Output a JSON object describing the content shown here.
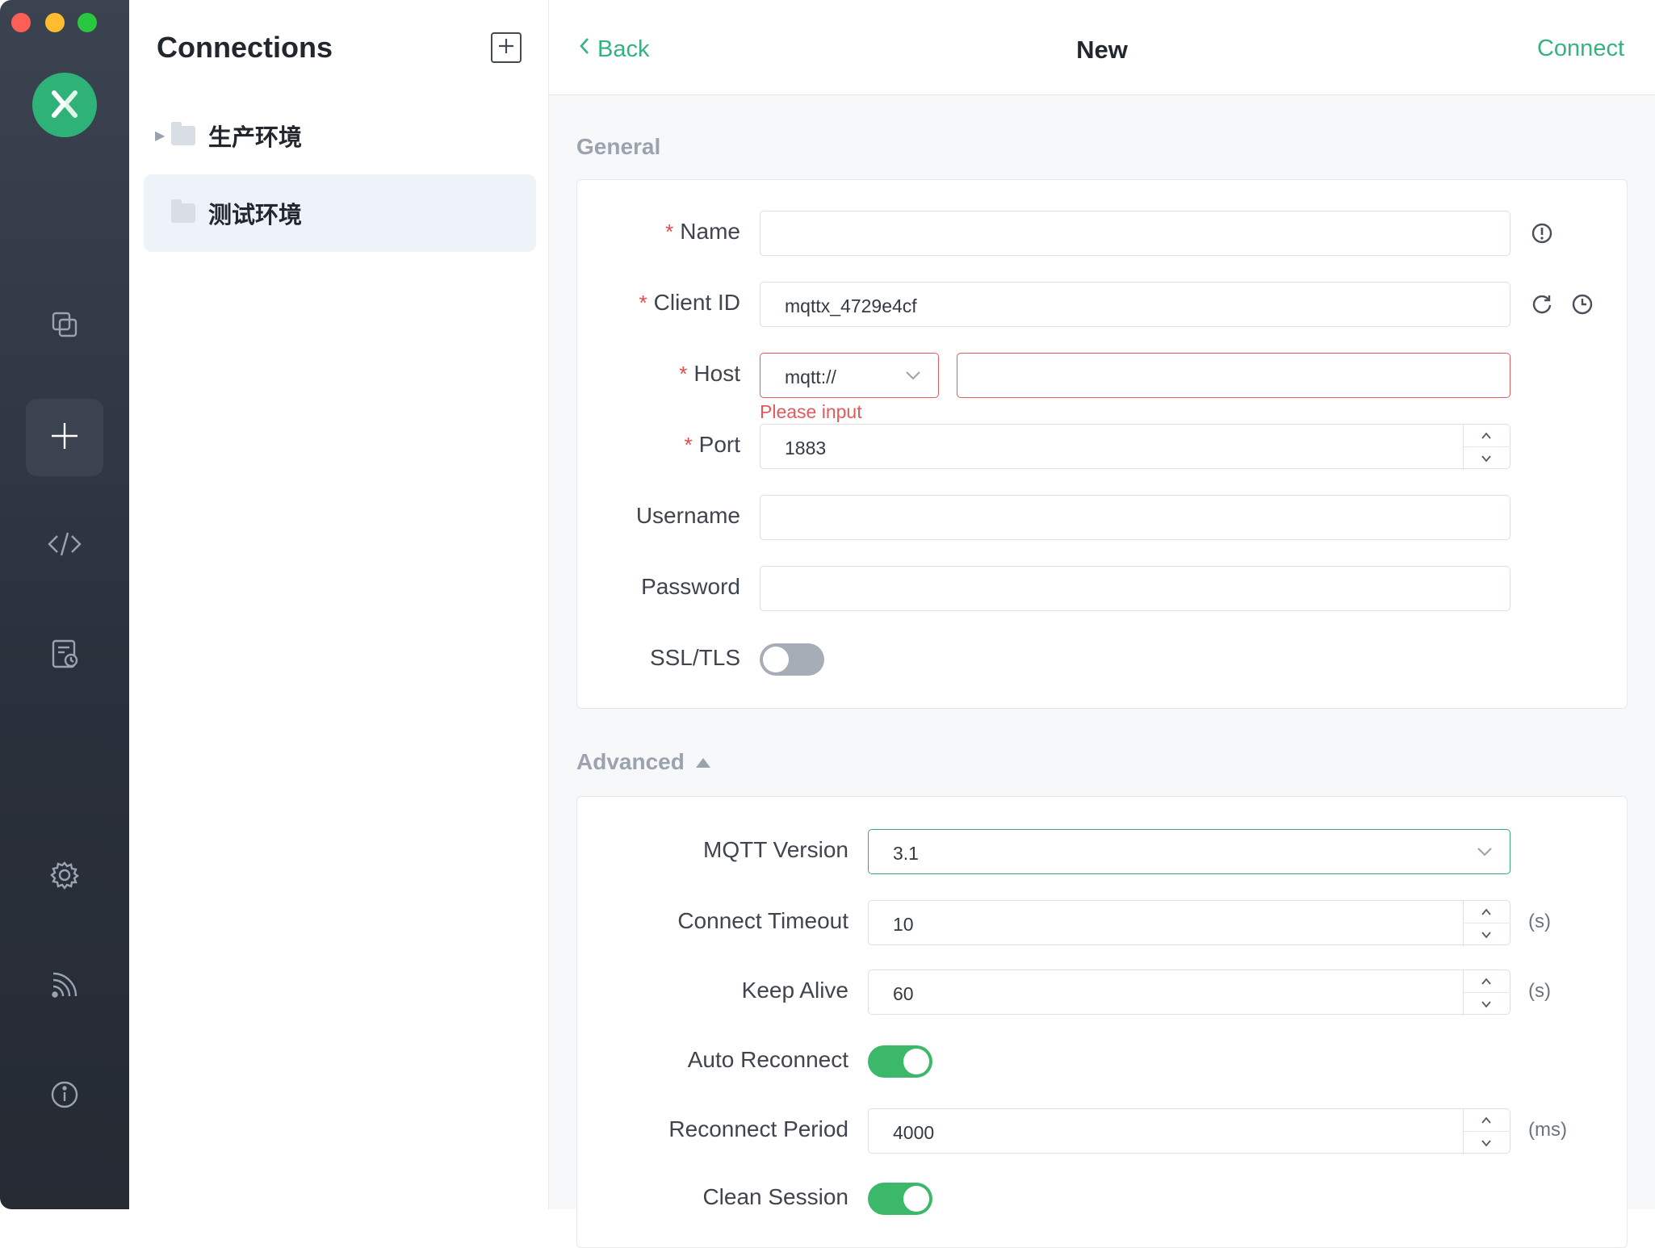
{
  "window": {
    "title": "New"
  },
  "rail": {
    "items": [
      {
        "name": "connections",
        "icon": "copy-icon",
        "active": false
      },
      {
        "name": "new-connection",
        "icon": "plus-icon",
        "active": true
      },
      {
        "name": "script",
        "icon": "code-icon",
        "active": false
      },
      {
        "name": "log",
        "icon": "log-clock-icon",
        "active": false
      },
      {
        "name": "settings",
        "icon": "gear-icon",
        "active": false
      },
      {
        "name": "subscriptions",
        "icon": "rss-icon",
        "active": false
      },
      {
        "name": "about",
        "icon": "info-icon",
        "active": false
      }
    ]
  },
  "connections": {
    "title": "Connections",
    "groups": [
      {
        "label": "生产环境",
        "expandable": true,
        "selected": false
      },
      {
        "label": "测试环境",
        "expandable": false,
        "selected": true
      }
    ]
  },
  "header": {
    "back_label": "Back",
    "title": "New",
    "connect_label": "Connect"
  },
  "general": {
    "section_title": "General",
    "name": {
      "label": "Name",
      "value": ""
    },
    "client_id": {
      "label": "Client ID",
      "value": "mqttx_4729e4cf"
    },
    "host": {
      "label": "Host",
      "protocol": "mqtt://",
      "value": "",
      "error": "Please input"
    },
    "port": {
      "label": "Port",
      "value": "1883"
    },
    "username": {
      "label": "Username",
      "value": ""
    },
    "password": {
      "label": "Password",
      "value": ""
    },
    "ssl": {
      "label": "SSL/TLS",
      "enabled": false
    }
  },
  "advanced": {
    "section_title": "Advanced",
    "mqtt_version": {
      "label": "MQTT Version",
      "value": "3.1"
    },
    "connect_timeout": {
      "label": "Connect Timeout",
      "value": "10",
      "unit": "(s)"
    },
    "keep_alive": {
      "label": "Keep Alive",
      "value": "60",
      "unit": "(s)"
    },
    "auto_reconnect": {
      "label": "Auto Reconnect",
      "enabled": true
    },
    "reconnect_period": {
      "label": "Reconnect Period",
      "value": "4000",
      "unit": "(ms)"
    },
    "clean_session": {
      "label": "Clean Session",
      "enabled": true
    }
  },
  "colors": {
    "accent": "#34b37e",
    "error": "#e05b5b",
    "rail_bg": "#2b313c"
  }
}
